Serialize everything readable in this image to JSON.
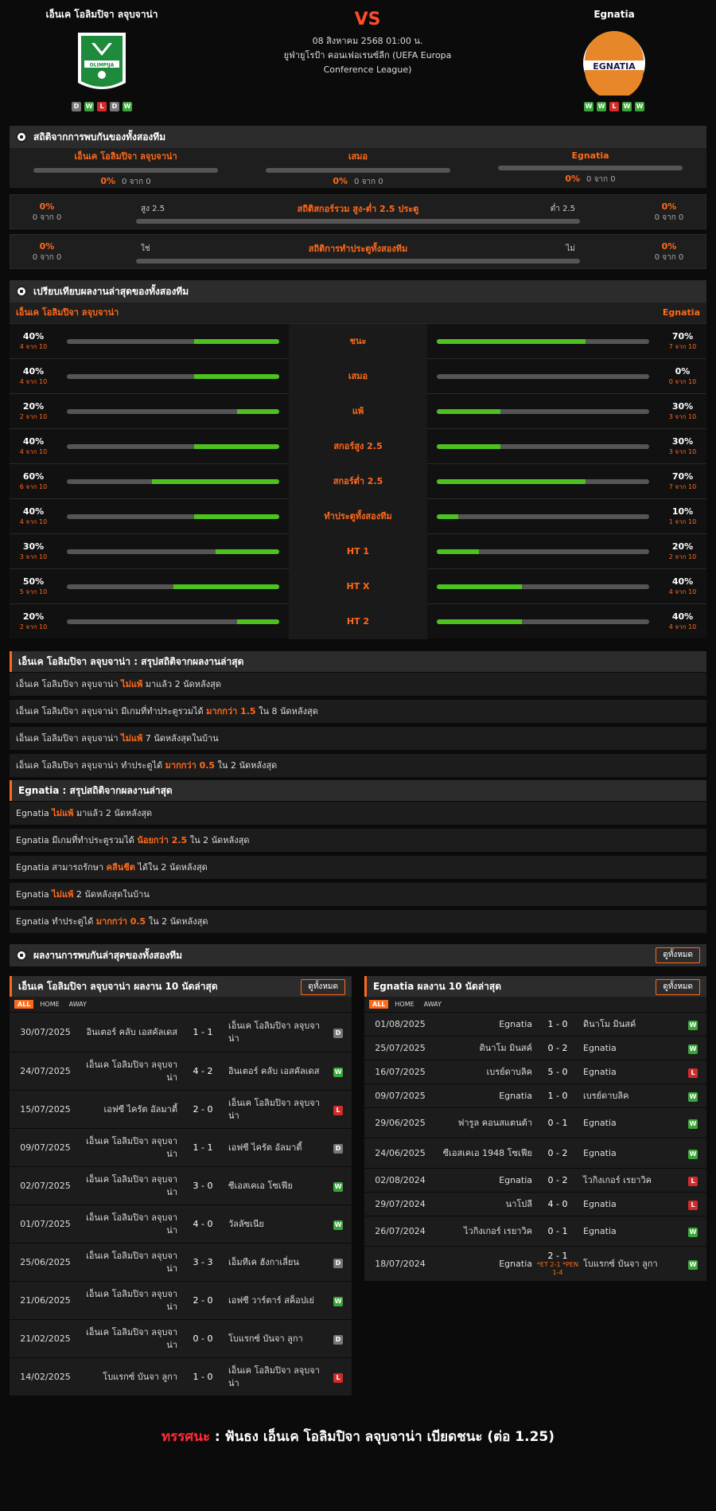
{
  "header": {
    "home": {
      "name": "เอ็นเค โอลิมปิจา ลจุบจาน่า",
      "logo_text": "OLIMPIJA",
      "form": [
        "D",
        "W",
        "L",
        "D",
        "W"
      ]
    },
    "away": {
      "name": "Egnatia",
      "logo_text": "EGNATIA",
      "form": [
        "W",
        "W",
        "L",
        "W",
        "W"
      ]
    },
    "vs": "VS",
    "date": "08 สิงหาคม 2568 01:00 น.",
    "competition_line1": "ยูฟ่ายูโรป้า คอนเฟอเรนซ์ลีก (UEFA Europa",
    "competition_line2": "Conference League)"
  },
  "h2h": {
    "title": "สถิติจากการพบกันของทั้งสองทีม",
    "cols": [
      {
        "label": "เอ็นเค โอลิมปิจา ลจุบจาน่า",
        "pct": "0%",
        "of": "0 จาก 0"
      },
      {
        "label": "เสมอ",
        "pct": "0%",
        "of": "0 จาก 0"
      },
      {
        "label": "Egnatia",
        "pct": "0%",
        "of": "0 จาก 0"
      }
    ],
    "ou": {
      "title": "สถิติสกอร์รวม สูง-ต่ำ 2.5 ประตู",
      "left_label": "สูง 2.5",
      "right_label": "ต่ำ 2.5",
      "lpct": "0%",
      "lof": "0 จาก 0",
      "rpct": "0%",
      "rof": "0 จาก 0"
    },
    "btts": {
      "title": "สถิติการทำประตูทั้งสองทีม",
      "left_label": "ใช่",
      "right_label": "ไม่",
      "lpct": "0%",
      "lof": "0 จาก 0",
      "rpct": "0%",
      "rof": "0 จาก 0"
    }
  },
  "compare": {
    "title": "เปรียบเทียบผลงานล่าสุดของทั้งสองทีม",
    "home": "เอ็นเค โอลิมปิจา ลจุบจาน่า",
    "away": "Egnatia",
    "rows": [
      {
        "label": "ชนะ",
        "l": "40%",
        "lof": "4 จาก 10",
        "lv": 40,
        "r": "70%",
        "rof": "7 จาก 10",
        "rv": 70
      },
      {
        "label": "เสมอ",
        "l": "40%",
        "lof": "4 จาก 10",
        "lv": 40,
        "r": "0%",
        "rof": "0 จาก 10",
        "rv": 0
      },
      {
        "label": "แพ้",
        "l": "20%",
        "lof": "2 จาก 10",
        "lv": 20,
        "r": "30%",
        "rof": "3 จาก 10",
        "rv": 30
      },
      {
        "label": "สกอร์สูง 2.5",
        "l": "40%",
        "lof": "4 จาก 10",
        "lv": 40,
        "r": "30%",
        "rof": "3 จาก 10",
        "rv": 30
      },
      {
        "label": "สกอร์ต่ำ 2.5",
        "l": "60%",
        "lof": "6 จาก 10",
        "lv": 60,
        "r": "70%",
        "rof": "7 จาก 10",
        "rv": 70
      },
      {
        "label": "ทำประตูทั้งสองทีม",
        "l": "40%",
        "lof": "4 จาก 10",
        "lv": 40,
        "r": "10%",
        "rof": "1 จาก 10",
        "rv": 10
      },
      {
        "label": "HT 1",
        "l": "30%",
        "lof": "3 จาก 10",
        "lv": 30,
        "r": "20%",
        "rof": "2 จาก 10",
        "rv": 20
      },
      {
        "label": "HT X",
        "l": "50%",
        "lof": "5 จาก 10",
        "lv": 50,
        "r": "40%",
        "rof": "4 จาก 10",
        "rv": 40
      },
      {
        "label": "HT 2",
        "l": "20%",
        "lof": "2 จาก 10",
        "lv": 20,
        "r": "40%",
        "rof": "4 จาก 10",
        "rv": 40
      }
    ]
  },
  "summary_home": {
    "title": "เอ็นเค โอลิมปิจา ลจุบจาน่า : สรุปสถิติจากผลงานล่าสุด",
    "lines": [
      {
        "a": "เอ็นเค โอลิมปิจา ลจุบจาน่า ",
        "b": "ไม่แพ้",
        "c": " มาแล้ว 2 นัดหลังสุด"
      },
      {
        "a": "เอ็นเค โอลิมปิจา ลจุบจาน่า มีเกมที่ทำประตูรวมได้ ",
        "b": "มากกว่า 1.5",
        "c": " ใน 8 นัดหลังสุด"
      },
      {
        "a": "เอ็นเค โอลิมปิจา ลจุบจาน่า ",
        "b": "ไม่แพ้",
        "c": " 7 นัดหลังสุดในบ้าน"
      },
      {
        "a": "เอ็นเค โอลิมปิจา ลจุบจาน่า ทำประตูได้ ",
        "b": "มากกว่า 0.5",
        "c": " ใน 2 นัดหลังสุด"
      }
    ]
  },
  "summary_away": {
    "title": "Egnatia : สรุปสถิติจากผลงานล่าสุด",
    "lines": [
      {
        "a": "Egnatia ",
        "b": "ไม่แพ้",
        "c": " มาแล้ว 2 นัดหลังสุด"
      },
      {
        "a": "Egnatia มีเกมที่ทำประตูรวมได้ ",
        "b": "น้อยกว่า 2.5",
        "c": " ใน 2 นัดหลังสุด"
      },
      {
        "a": "Egnatia สามารถรักษา ",
        "b": "คลีนชีต",
        "c": " ได้ใน 2 นัดหลังสุด"
      },
      {
        "a": "Egnatia ",
        "b": "ไม่แพ้",
        "c": " 2 นัดหลังสุดในบ้าน"
      },
      {
        "a": "Egnatia ทำประตูได้ ",
        "b": "มากกว่า 0.5",
        "c": " ใน 2 นัดหลังสุด"
      }
    ]
  },
  "recent": {
    "title": "ผลงานการพบกันล่าสุดของทั้งสองทีม",
    "see_all": "ดูทั้งหมด"
  },
  "tabs": [
    "ALL",
    "HOME",
    "AWAY"
  ],
  "home_list": {
    "title": "เอ็นเค โอลิมปิจา ลจุบจาน่า ผลงาน 10 นัดล่าสุด",
    "see_all": "ดูทั้งหมด",
    "matches": [
      {
        "date": "30/07/2025",
        "home": "อินเตอร์ คลับ เอสคัลเดส",
        "score": "1 - 1",
        "extra": "",
        "away": "เอ็นเค โอลิมปิจา ลจุบจาน่า",
        "res": "D"
      },
      {
        "date": "24/07/2025",
        "home": "เอ็นเค โอลิมปิจา ลจุบจาน่า",
        "score": "4 - 2",
        "extra": "",
        "away": "อินเตอร์ คลับ เอสคัลเดส",
        "res": "W"
      },
      {
        "date": "15/07/2025",
        "home": "เอฟซี ไครัต อัลมาตี้",
        "score": "2 - 0",
        "extra": "",
        "away": "เอ็นเค โอลิมปิจา ลจุบจาน่า",
        "res": "L"
      },
      {
        "date": "09/07/2025",
        "home": "เอ็นเค โอลิมปิจา ลจุบจาน่า",
        "score": "1 - 1",
        "extra": "",
        "away": "เอฟซี ไครัต อัลมาตี้",
        "res": "D"
      },
      {
        "date": "02/07/2025",
        "home": "เอ็นเค โอลิมปิจา ลจุบจาน่า",
        "score": "3 - 0",
        "extra": "",
        "away": "ซีเอสเคเอ โซเฟีย",
        "res": "W"
      },
      {
        "date": "01/07/2025",
        "home": "เอ็นเค โอลิมปิจา ลจุบจาน่า",
        "score": "4 - 0",
        "extra": "",
        "away": "วัลลัซเนีย",
        "res": "W"
      },
      {
        "date": "25/06/2025",
        "home": "เอ็นเค โอลิมปิจา ลจุบจาน่า",
        "score": "3 - 3",
        "extra": "",
        "away": "เอ็มทีเค ฮังกาเลี่ยน",
        "res": "D"
      },
      {
        "date": "21/06/2025",
        "home": "เอ็นเค โอลิมปิจา ลจุบจาน่า",
        "score": "2 - 0",
        "extra": "",
        "away": "เอฟซี วาร์ตาร์ สค็อปเย่",
        "res": "W"
      },
      {
        "date": "21/02/2025",
        "home": "เอ็นเค โอลิมปิจา ลจุบจาน่า",
        "score": "0 - 0",
        "extra": "",
        "away": "โบแรกซ์ บันจา ลูกา",
        "res": "D"
      },
      {
        "date": "14/02/2025",
        "home": "โบแรกซ์ บันจา ลูกา",
        "score": "1 - 0",
        "extra": "",
        "away": "เอ็นเค โอลิมปิจา ลจุบจาน่า",
        "res": "L"
      }
    ]
  },
  "away_list": {
    "title": "Egnatia ผลงาน 10 นัดล่าสุด",
    "see_all": "ดูทั้งหมด",
    "matches": [
      {
        "date": "01/08/2025",
        "home": "Egnatia",
        "score": "1 - 0",
        "extra": "",
        "away": "ดินาโม มินสค์",
        "res": "W"
      },
      {
        "date": "25/07/2025",
        "home": "ดินาโม มินสค์",
        "score": "0 - 2",
        "extra": "",
        "away": "Egnatia",
        "res": "W"
      },
      {
        "date": "16/07/2025",
        "home": "เบรย์ดาบลิค",
        "score": "5 - 0",
        "extra": "",
        "away": "Egnatia",
        "res": "L"
      },
      {
        "date": "09/07/2025",
        "home": "Egnatia",
        "score": "1 - 0",
        "extra": "",
        "away": "เบรย์ดาบลิค",
        "res": "W"
      },
      {
        "date": "29/06/2025",
        "home": "ฟารูล คอนสแตนต้า",
        "score": "0 - 1",
        "extra": "",
        "away": "Egnatia",
        "res": "W"
      },
      {
        "date": "24/06/2025",
        "home": "ซีเอสเคเอ 1948 โซเฟีย",
        "score": "0 - 2",
        "extra": "",
        "away": "Egnatia",
        "res": "W"
      },
      {
        "date": "02/08/2024",
        "home": "Egnatia",
        "score": "0 - 2",
        "extra": "",
        "away": "ไวกิงเกอร์ เรยาวิค",
        "res": "L"
      },
      {
        "date": "29/07/2024",
        "home": "นาโปลี",
        "score": "4 - 0",
        "extra": "",
        "away": "Egnatia",
        "res": "L"
      },
      {
        "date": "26/07/2024",
        "home": "ไวกิงเกอร์ เรยาวิค",
        "score": "0 - 1",
        "extra": "",
        "away": "Egnatia",
        "res": "W"
      },
      {
        "date": "18/07/2024",
        "home": "Egnatia",
        "score": "2 - 1",
        "extra": "*ET 2-1 *PEN 1-4",
        "away": "โบแรกซ์ บันจา ลูกา",
        "res": "W"
      }
    ]
  },
  "footer": {
    "label": "ทรรศนะ",
    "sep": " : ",
    "text": "ฟันธง เอ็นเค โอลิมปิจา ลจุบจาน่า เบียดชนะ (ต่อ 1.25)"
  },
  "colors": {
    "accent": "#ff6a1a",
    "win": "#3aa63a",
    "loss": "#d12b2b",
    "draw": "#777777",
    "bar_fill": "#4dc21f"
  }
}
